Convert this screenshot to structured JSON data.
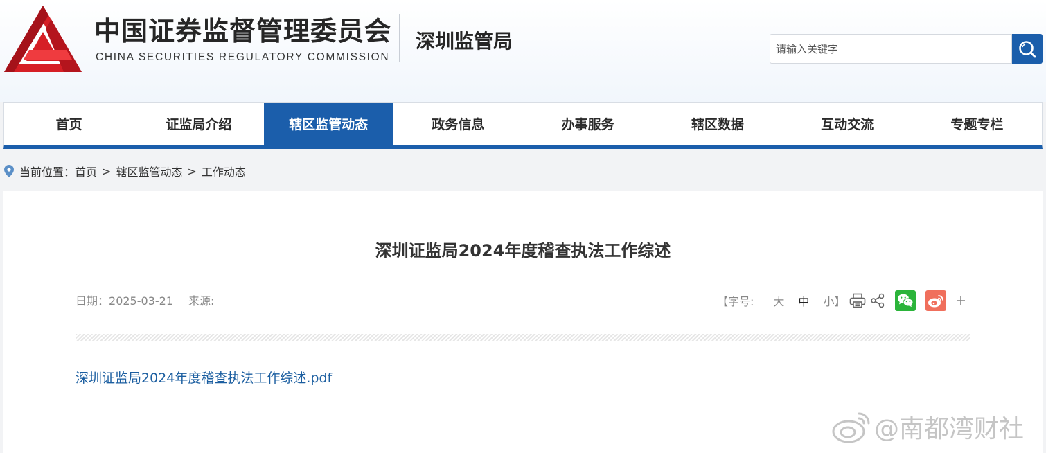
{
  "header": {
    "org_name_cn": "中国证券监督管理委员会",
    "org_name_en": "CHINA SECURITIES REGULATORY COMMISSION",
    "sub_title": "深圳监管局",
    "search": {
      "placeholder": "请输入关键字",
      "value": ""
    }
  },
  "nav": {
    "items": [
      {
        "label": "首页"
      },
      {
        "label": "证监局介绍"
      },
      {
        "label": "辖区监管动态",
        "active": true
      },
      {
        "label": "政务信息"
      },
      {
        "label": "办事服务"
      },
      {
        "label": "辖区数据"
      },
      {
        "label": "互动交流"
      },
      {
        "label": "专题专栏"
      }
    ]
  },
  "breadcrumb": {
    "prefix": "当前位置：",
    "items": [
      "首页",
      "辖区监管动态",
      "工作动态"
    ],
    "separator": ">"
  },
  "article": {
    "title": "深圳证监局2024年度稽查执法工作综述",
    "date_label": "日期：",
    "date": "2025-03-21",
    "source_label": "来源:",
    "font_size_label": "【字号:",
    "font_sizes": [
      "大",
      "中",
      "小"
    ],
    "font_size_close": "】",
    "font_size_selected": "中",
    "attachment": "深圳证监局2024年度稽查执法工作综述.pdf"
  },
  "watermark": {
    "text": "@南都湾财社"
  },
  "colors": {
    "brand_blue": "#1b5eab",
    "logo_red": "#d61f26",
    "wechat_green": "#2bb43a",
    "weibo_red": "#f06f5c",
    "link_blue": "#1b5ea0"
  },
  "icons": {
    "logo": "csrc-logo-icon",
    "search": "search-icon",
    "location": "location-pin-icon",
    "print": "print-icon",
    "share": "share-icon",
    "wechat": "wechat-icon",
    "weibo": "weibo-icon",
    "more": "plus-icon"
  }
}
